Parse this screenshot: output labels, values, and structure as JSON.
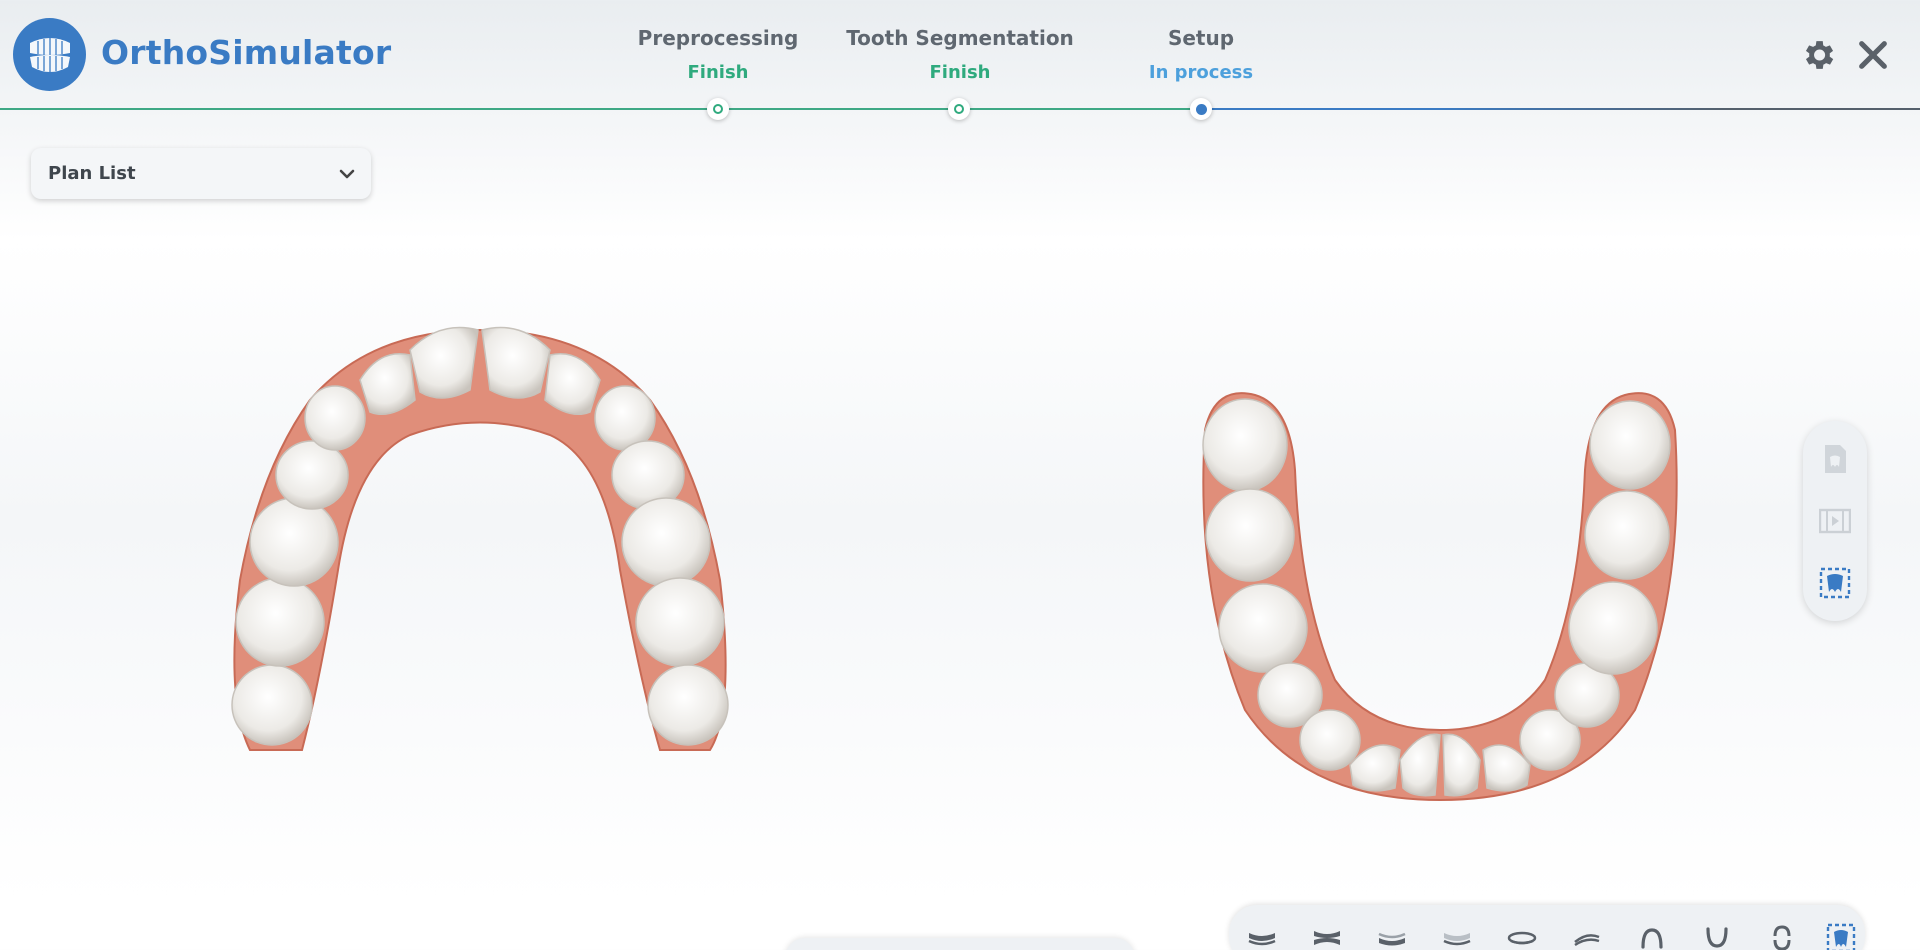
{
  "app": {
    "title": "OrthoSimulator",
    "accent": "#3a7bc4",
    "done_color": "#2faa7e",
    "in_process_color": "#4da0dc"
  },
  "steps": [
    {
      "name": "Preprocessing",
      "status": "Finish",
      "state": "done"
    },
    {
      "name": "Tooth Segmentation",
      "status": "Finish",
      "state": "done"
    },
    {
      "name": "Setup",
      "status": "In process",
      "state": "active"
    }
  ],
  "header_icons": [
    "gear-icon",
    "close-icon"
  ],
  "plan_list": {
    "label": "Plan List",
    "icon": "chevron-down-icon"
  },
  "viewport": {
    "models": [
      "upper-arch",
      "lower-arch"
    ]
  },
  "side_tools": [
    "tooth-report-icon",
    "video-icon",
    "tooth-select-icon"
  ],
  "bottom_tools": [
    "upper-jaw-view-icon",
    "both-jaws-view-icon",
    "lower-jaw-view-icon",
    "lower-jaw-faded-icon",
    "upper-occlusal-icon",
    "lower-occlusal-icon",
    "upper-arch-icon",
    "lower-arch-icon",
    "open-bite-icon",
    "tooth-frame-icon"
  ]
}
